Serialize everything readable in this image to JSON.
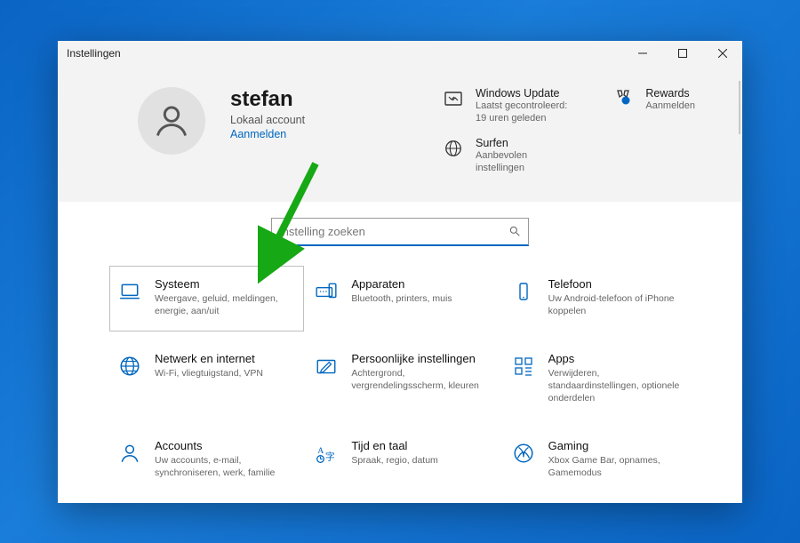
{
  "window": {
    "title": "Instellingen"
  },
  "user": {
    "name": "stefan",
    "subtitle": "Lokaal account",
    "signin": "Aanmelden"
  },
  "status": {
    "update": {
      "title": "Windows Update",
      "line1": "Laatst gecontroleerd:",
      "line2": "19 uren geleden"
    },
    "surf": {
      "title": "Surfen",
      "line1": "Aanbevolen",
      "line2": "instellingen"
    },
    "rewards": {
      "title": "Rewards",
      "line1": "Aanmelden"
    }
  },
  "search": {
    "placeholder": "Instelling zoeken"
  },
  "tiles": [
    {
      "title": "Systeem",
      "desc": "Weergave, geluid, meldingen, energie, aan/uit"
    },
    {
      "title": "Apparaten",
      "desc": "Bluetooth, printers, muis"
    },
    {
      "title": "Telefoon",
      "desc": "Uw Android-telefoon of iPhone koppelen"
    },
    {
      "title": "Netwerk en internet",
      "desc": "Wi-Fi, vliegtuigstand, VPN"
    },
    {
      "title": "Persoonlijke instellingen",
      "desc": "Achtergrond, vergrendelingsscherm, kleuren"
    },
    {
      "title": "Apps",
      "desc": "Verwijderen, standaardinstellingen, optionele onderdelen"
    },
    {
      "title": "Accounts",
      "desc": "Uw accounts, e-mail, synchroniseren, werk, familie"
    },
    {
      "title": "Tijd en taal",
      "desc": "Spraak, regio, datum"
    },
    {
      "title": "Gaming",
      "desc": "Xbox Game Bar, opnames, Gamemodus"
    }
  ]
}
